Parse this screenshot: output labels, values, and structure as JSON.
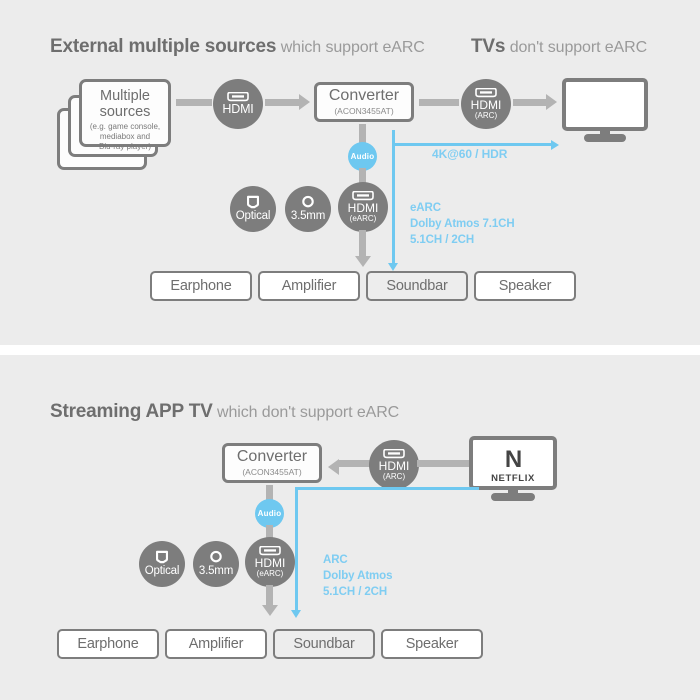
{
  "colors": {
    "panel_bg": "#ececec",
    "page_bg": "#ffffff",
    "gray": "#7d7d7d",
    "line_gray": "#b3b3b3",
    "blue": "#6ec8f0",
    "text_gray": "#6e6e6e",
    "text_light": "#9a9a9a"
  },
  "section_top": {
    "heading_strong": "External multiple sources",
    "heading_light": "which support eARC",
    "heading2_strong": "TVs",
    "heading2_light": "don't support eARC",
    "source": {
      "title_line1": "Multiple",
      "title_line2": "sources",
      "sub": "(e.g. game console,\nmediabox and\nBlu-ray player)"
    },
    "hdmi_in": {
      "label": "HDMI",
      "sub": ""
    },
    "converter": {
      "title": "Converter",
      "model": "(ACON3455AT)"
    },
    "hdmi_out": {
      "label": "HDMI",
      "sub": "(ARC)"
    },
    "audio_badge": "Audio",
    "audio_outputs": [
      {
        "label": "Optical",
        "sub": "",
        "icon": "optical-icon"
      },
      {
        "label": "3.5mm",
        "sub": "",
        "icon": "jack-icon"
      },
      {
        "label": "HDMI",
        "sub": "(eARC)",
        "icon": "hdmi-icon"
      }
    ],
    "video_link_label": "4K@60 / HDR",
    "audio_link_label": "eARC\nDolby Atmos 7.1CH\n5.1CH / 2CH",
    "outputs": [
      {
        "label": "Earphone",
        "dim": false
      },
      {
        "label": "Amplifier",
        "dim": false
      },
      {
        "label": "Soundbar",
        "dim": true
      },
      {
        "label": "Speaker",
        "dim": false
      }
    ]
  },
  "section_bottom": {
    "heading_strong": "Streaming APP TV",
    "heading_light": "which don't support eARC",
    "converter": {
      "title": "Converter",
      "model": "(ACON3455AT)"
    },
    "hdmi_arc": {
      "label": "HDMI",
      "sub": "(ARC)"
    },
    "tv": {
      "logo_mark": "N",
      "logo_word": "NETFLIX"
    },
    "audio_badge": "Audio",
    "audio_outputs": [
      {
        "label": "Optical",
        "sub": "",
        "icon": "optical-icon"
      },
      {
        "label": "3.5mm",
        "sub": "",
        "icon": "jack-icon"
      },
      {
        "label": "HDMI",
        "sub": "(eARC)",
        "icon": "hdmi-icon"
      }
    ],
    "audio_link_label": "ARC\nDolby Atmos\n5.1CH / 2CH",
    "outputs": [
      {
        "label": "Earphone",
        "dim": false
      },
      {
        "label": "Amplifier",
        "dim": false
      },
      {
        "label": "Soundbar",
        "dim": true
      },
      {
        "label": "Speaker",
        "dim": false
      }
    ]
  }
}
